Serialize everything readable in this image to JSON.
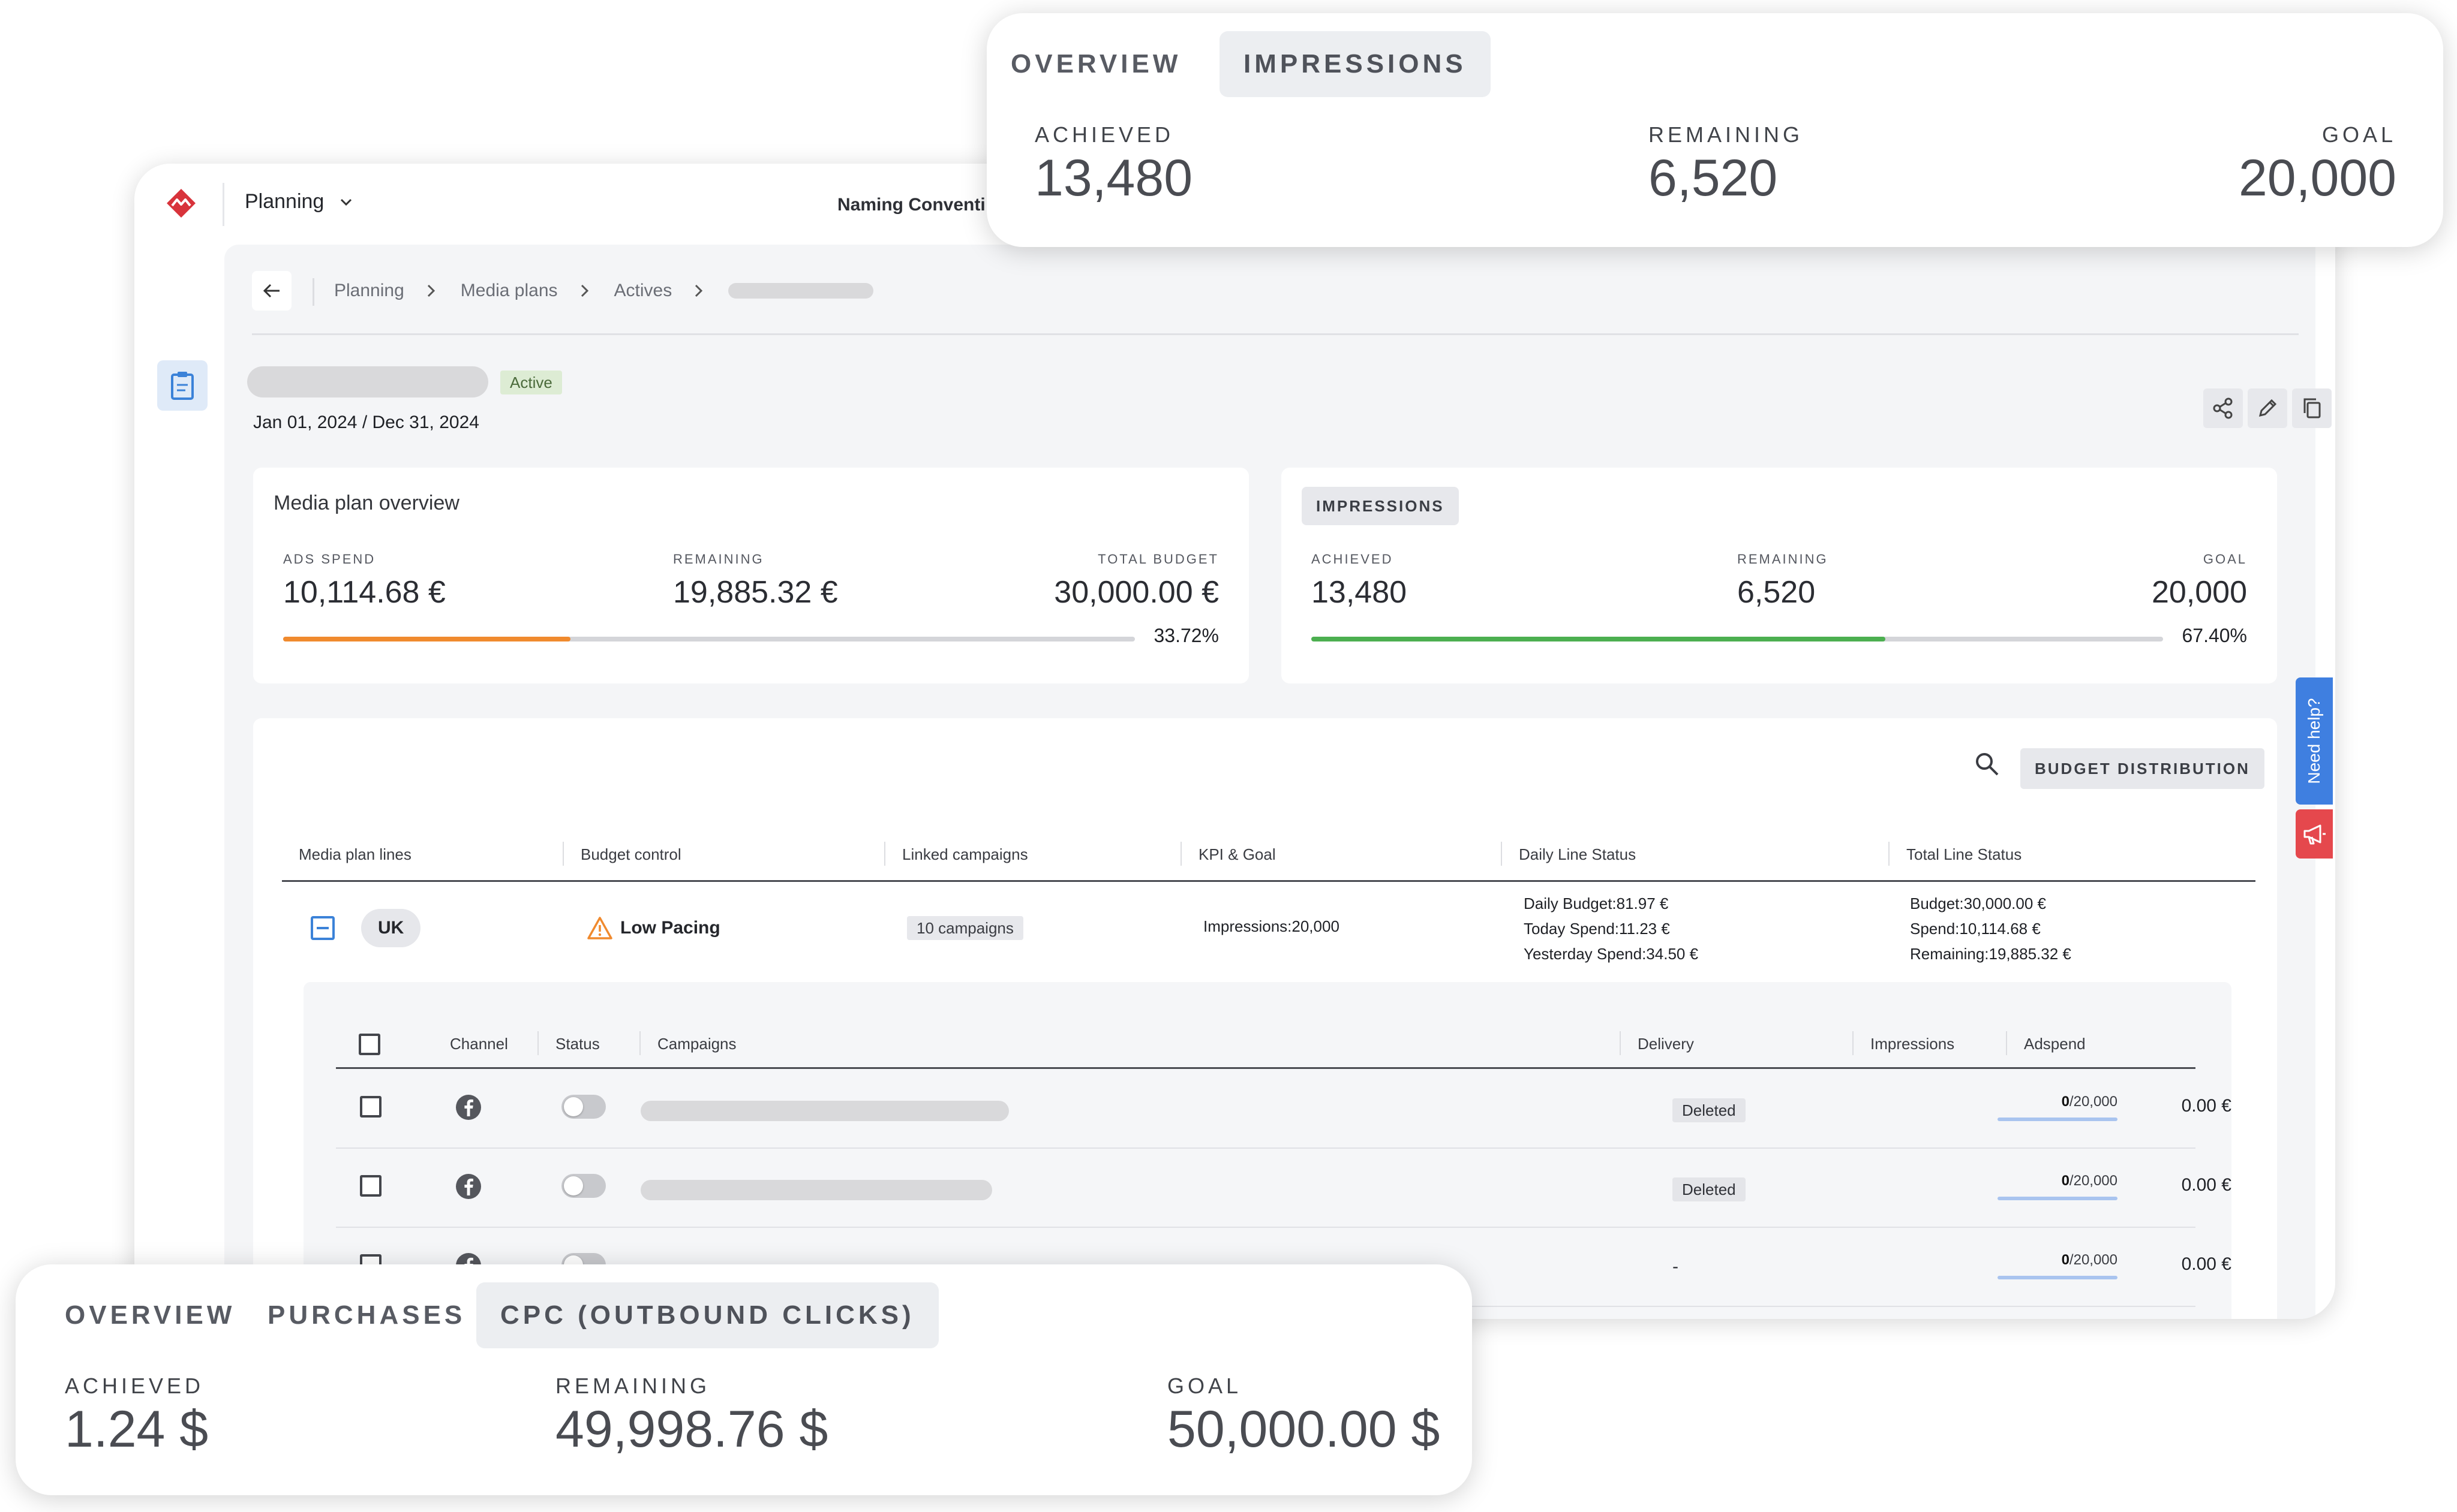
{
  "topbar": {
    "module_label": "Planning",
    "naming_label": "Naming Conventi"
  },
  "breadcrumb": [
    "Planning",
    "Media plans",
    "Actives"
  ],
  "plan": {
    "status": "Active",
    "date_range": "Jan 01, 2024 / Dec 31, 2024"
  },
  "overview_card": {
    "title": "Media plan overview",
    "ads_spend_label": "ADS SPEND",
    "ads_spend": "10,114.68 €",
    "remaining_label": "REMAINING",
    "remaining": "19,885.32 €",
    "total_label": "TOTAL BUDGET",
    "total": "30,000.00 €",
    "progress": 0.3372,
    "progress_label": "33.72%",
    "bar_color": "#f08a2e"
  },
  "impressions_card": {
    "tab": "IMPRESSIONS",
    "achieved_label": "ACHIEVED",
    "achieved": "13,480",
    "remaining_label": "REMAINING",
    "remaining": "6,520",
    "goal_label": "GOAL",
    "goal": "20,000",
    "progress": 0.674,
    "progress_label": "67.40%",
    "bar_color": "#4caf50"
  },
  "table": {
    "search_icon": "search-icon",
    "budget_distribution": "BUDGET DISTRIBUTION",
    "headers": [
      "Media plan lines",
      "Budget control",
      "Linked campaigns",
      "KPI & Goal",
      "Daily Line Status",
      "Total Line Status"
    ],
    "line": {
      "name": "UK",
      "budget_control": "Low Pacing",
      "linked": "10 campaigns",
      "kpi": "Impressions:20,000",
      "daily": [
        "Daily Budget:81.97 €",
        "Today Spend:11.23 €",
        "Yesterday Spend:34.50 €"
      ],
      "total": [
        "Budget:30,000.00 €",
        "Spend:10,114.68 €",
        "Remaining:19,885.32 €"
      ]
    }
  },
  "subtable": {
    "headers": [
      "Channel",
      "Status",
      "Campaigns",
      "Delivery",
      "Impressions",
      "Adspend"
    ],
    "rows": [
      {
        "delivery": "Deleted",
        "imp_done": "0",
        "imp_goal": "/20,000",
        "adspend": "0.00 €"
      },
      {
        "delivery": "Deleted",
        "imp_done": "0",
        "imp_goal": "/20,000",
        "adspend": "0.00 €"
      },
      {
        "delivery": "-",
        "imp_done": "0",
        "imp_goal": "/20,000",
        "adspend": "0.00 €"
      }
    ]
  },
  "widgets": {
    "need_help": "Need help?"
  },
  "zoom_top": {
    "tabs": [
      "OVERVIEW",
      "IMPRESSIONS"
    ],
    "active_tab": "IMPRESSIONS",
    "achieved_label": "ACHIEVED",
    "achieved": "13,480",
    "remaining_label": "REMAINING",
    "remaining": "6,520",
    "goal_label": "GOAL",
    "goal": "20,000"
  },
  "zoom_bottom": {
    "tabs": [
      "OVERVIEW",
      "PURCHASES",
      "CPC (OUTBOUND CLICKS)"
    ],
    "active_tab": "CPC (OUTBOUND CLICKS)",
    "achieved_label": "ACHIEVED",
    "achieved": "1.24 $",
    "remaining_label": "REMAINING",
    "remaining": "49,998.76 $",
    "goal_label": "GOAL",
    "goal": "50,000.00 $"
  },
  "colors": {
    "accent_blue": "#3f7fe0",
    "brand_red": "#d8333b",
    "announce_red": "#e5484d"
  }
}
